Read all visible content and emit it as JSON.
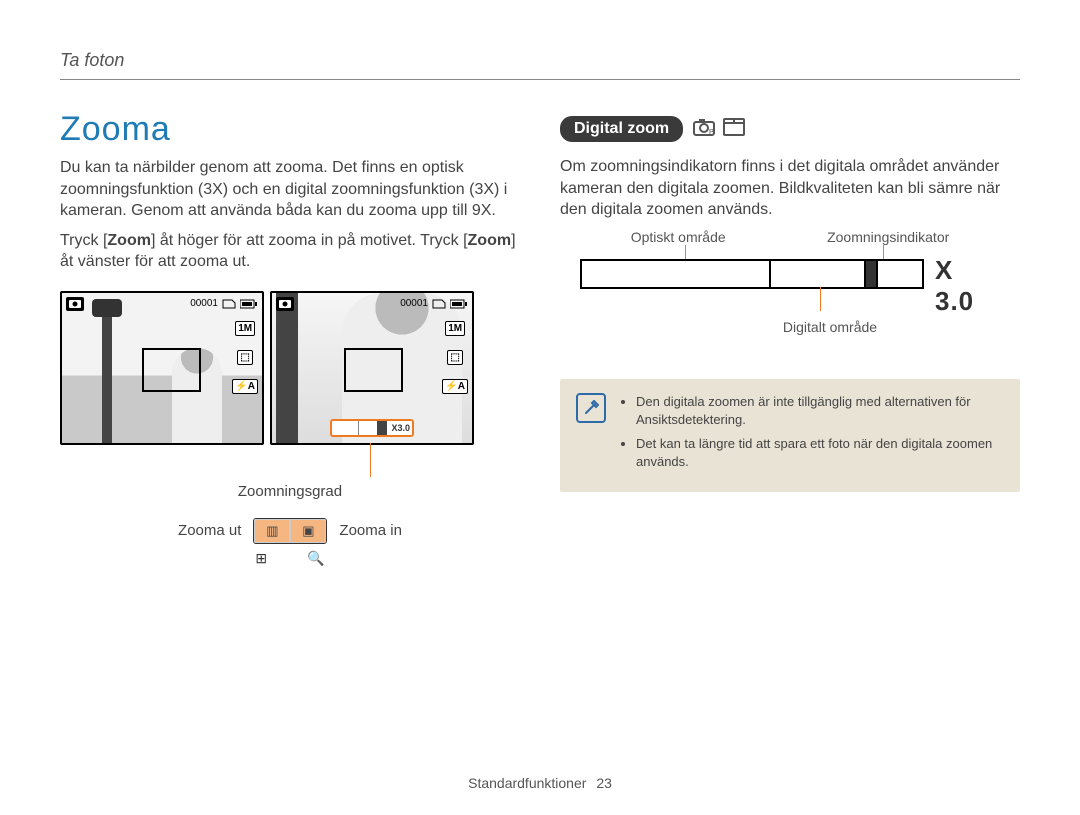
{
  "running_head": "Ta foton",
  "left": {
    "heading": "Zooma",
    "p1": "Du kan ta närbilder genom att zooma. Det finns en optisk zoomningsfunktion (3X) och en digital zoomningsfunktion (3X) i kameran. Genom att använda båda kan du zooma upp till 9X.",
    "p2_pre": "Tryck [",
    "p2_kw1": "Zoom",
    "p2_mid": "] åt höger för att zooma in på motivet. Tryck [",
    "p2_kw2": "Zoom",
    "p2_post": "] åt vänster för att zooma ut.",
    "lcd_counter": "00001",
    "lcd_side1": "1M",
    "lcd_side2": "⬚",
    "lcd_side3": "⚡A",
    "zoom_bar_text": "X3.0",
    "caption_zoomgrade": "Zoomningsgrad",
    "zoom_out": "Zooma ut",
    "zoom_in": "Zooma in",
    "rocker_left_glyph": "▥",
    "rocker_right_glyph": "▣",
    "icon_out": "⊞",
    "icon_in": "🔍"
  },
  "right": {
    "pill": "Digital zoom",
    "p1": "Om zoomningsindikatorn finns i det digitala området använder kameran den digitala zoomen. Bildkvaliteten kan bli sämre när den digitala zoomen används.",
    "label_optical": "Optiskt område",
    "label_indicator": "Zoomningsindikator",
    "label_digital": "Digitalt område",
    "mag": "X 3.0",
    "note1": "Den digitala zoomen är inte tillgänglig med alternativen för Ansiktsdetektering.",
    "note2": "Det kan ta längre tid att spara ett foto när den digitala zoomen används."
  },
  "footer": {
    "label": "Standardfunktioner",
    "page": "23"
  }
}
